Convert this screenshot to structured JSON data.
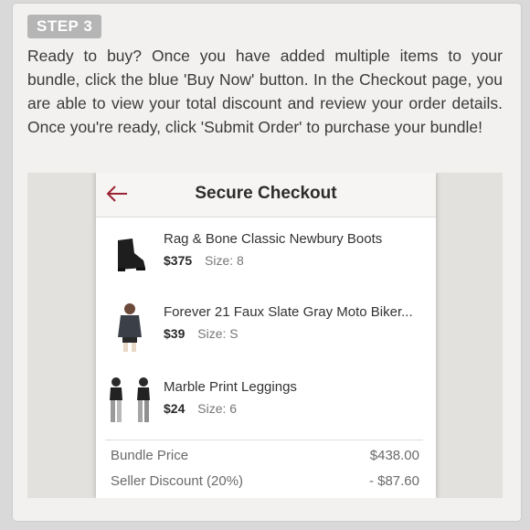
{
  "step": {
    "label": "STEP 3"
  },
  "instructions": "Ready to buy? Once you have added multiple items to your bundle, click the blue 'Buy Now' button. In the Checkout page, you are able to view your total discount and review your order details. Once you're ready, click 'Submit Order' to purchase your bundle!",
  "checkout": {
    "title": "Secure Checkout",
    "back_icon": "back-arrow-icon",
    "accent_color": "#9b2233",
    "items": [
      {
        "name": "Rag & Bone Classic Newbury Boots",
        "price": "$375",
        "size": "Size: 8",
        "thumb": "boot-image"
      },
      {
        "name": "Forever 21 Faux Slate Gray Moto Biker...",
        "price": "$39",
        "size": "Size: S",
        "thumb": "jacket-model-image"
      },
      {
        "name": "Marble Print Leggings",
        "price": "$24",
        "size": "Size: 6",
        "thumb": "leggings-model-image"
      }
    ],
    "summary": [
      {
        "label": "Bundle Price",
        "value": "$438.00"
      },
      {
        "label": "Seller Discount (20%)",
        "value": "- $87.60"
      }
    ]
  }
}
